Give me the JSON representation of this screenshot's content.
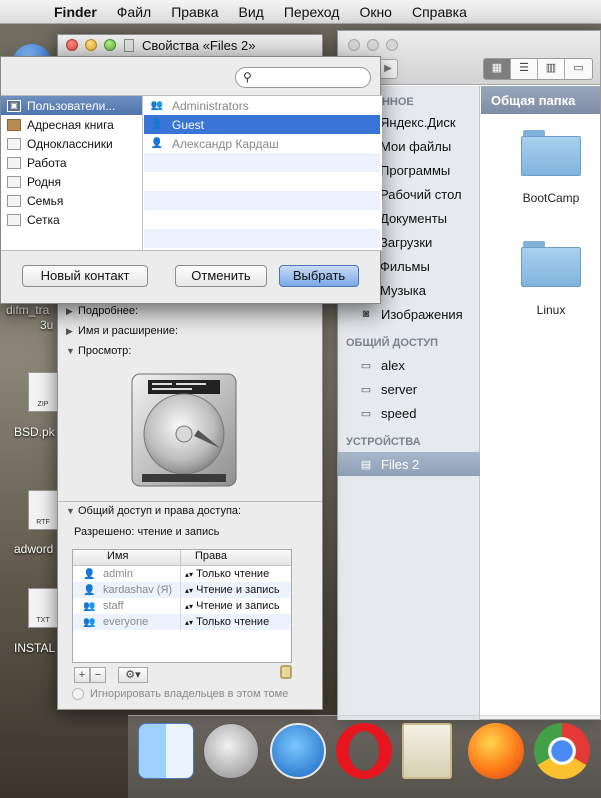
{
  "menubar": {
    "app": "Finder",
    "items": [
      "Файл",
      "Правка",
      "Вид",
      "Переход",
      "Окно",
      "Справка"
    ]
  },
  "desktop": {
    "labels": [
      "difm_tra",
      "3u",
      "BSD.pk",
      "adword",
      "INSTAL"
    ],
    "doc_types": [
      "ZIP",
      "RTF",
      "TXT"
    ]
  },
  "finder": {
    "sidebar_partial_heading": "АННОЕ",
    "favorites": [
      "Яндекс.Диск",
      "Мои файлы",
      "Программы",
      "Рабочий стол",
      "Документы",
      "Загрузки",
      "Фильмы",
      "Музыка",
      "Изображения"
    ],
    "shared_heading": "ОБЩИЙ ДОСТУП",
    "shared": [
      "alex",
      "server",
      "speed"
    ],
    "devices_heading": "УСТРОЙСТВА",
    "device": "Files 2",
    "content_title": "Общая папка",
    "folders": [
      "BootCamp",
      "Linux"
    ]
  },
  "props": {
    "title": "Свойства «Files 2»",
    "sections": {
      "more_info": "Подробнее:",
      "name_ext": "Имя и расширение:",
      "preview": "Просмотр:",
      "sharing": "Общий доступ и права доступа:"
    },
    "allowed": "Разрешено: чтение и запись",
    "table": {
      "col_name": "Имя",
      "col_rights": "Права",
      "rows": [
        {
          "name": "admin",
          "rights": "Только чтение"
        },
        {
          "name": "kardashav (Я)",
          "rights": "Чтение и запись"
        },
        {
          "name": "staff",
          "rights": "Чтение и запись"
        },
        {
          "name": "everyone",
          "rights": "Только чтение"
        }
      ]
    },
    "ignore_owners": "Игнорировать владельцев в этом томе"
  },
  "picker": {
    "search_placeholder": "",
    "groups": [
      "Пользователи...",
      "Адресная книга",
      "Одноклассники",
      "Работа",
      "Родня",
      "Семья",
      "Сетка"
    ],
    "contacts": [
      "Administrators",
      "Guest",
      "Александр Кардаш"
    ],
    "buttons": {
      "new_contact": "Новый контакт",
      "cancel": "Отменить",
      "choose": "Выбрать"
    }
  }
}
